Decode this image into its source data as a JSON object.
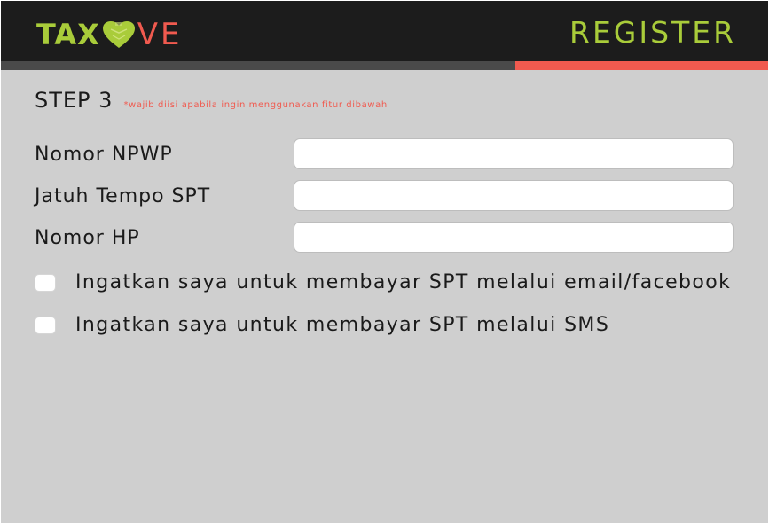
{
  "brand": {
    "name_part1": "TAX",
    "name_part2": "VE",
    "colors": {
      "green": "#a9cc3a",
      "red": "#f05a4f",
      "dark": "#1c1c1c"
    },
    "heart_icon": "heart-icon"
  },
  "header": {
    "title": "REGISTER"
  },
  "progress": {
    "fraction": 0.33
  },
  "step": {
    "label": "STEP 3",
    "note": "*wajib diisi apabila ingin menggunakan fitur dibawah"
  },
  "fields": [
    {
      "label": "Nomor NPWP",
      "value": "",
      "placeholder": ""
    },
    {
      "label": "Jatuh Tempo SPT",
      "value": "",
      "placeholder": ""
    },
    {
      "label": "Nomor HP",
      "value": "",
      "placeholder": ""
    }
  ],
  "reminders": [
    {
      "label": "Ingatkan saya untuk membayar SPT melalui email/facebook",
      "checked": false
    },
    {
      "label": "Ingatkan saya untuk membayar SPT melalui SMS",
      "checked": false
    }
  ]
}
